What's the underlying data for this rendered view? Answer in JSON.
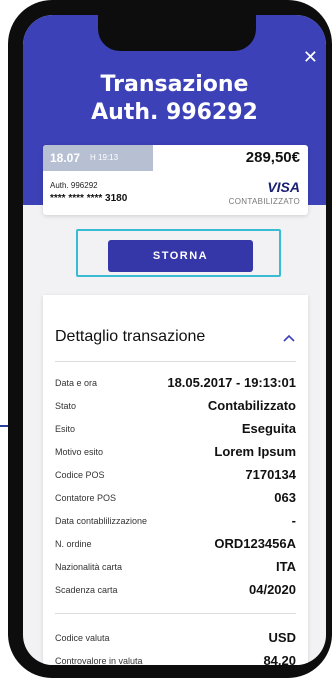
{
  "header": {
    "title_line1": "Transazione",
    "title_line2": "Auth. 996292",
    "close_label": "✕"
  },
  "card": {
    "date": "18.07",
    "time": "H 19:13",
    "amount": "289,50€",
    "auth": "Auth. 996292",
    "number": "**** **** **** 3180",
    "brand": "VISA",
    "status": "CONTABILIZZATO"
  },
  "action": {
    "storna_label": "STORNA"
  },
  "details": {
    "title": "Dettaglio transazione",
    "rows": [
      {
        "label": "Data e ora",
        "value": "18.05.2017 - 19:13:01"
      },
      {
        "label": "Stato",
        "value": "Contabilizzato"
      },
      {
        "label": "Esito",
        "value": "Eseguita"
      },
      {
        "label": "Motivo esito",
        "value": "Lorem Ipsum"
      },
      {
        "label": "Codice POS",
        "value": "7170134"
      },
      {
        "label": "Contatore POS",
        "value": "063"
      },
      {
        "label": "Data contablilizzazione",
        "value": "-"
      },
      {
        "label": "N. ordine",
        "value": "ORD123456A"
      },
      {
        "label": "Nazionalità carta",
        "value": "ITA"
      },
      {
        "label": "Scadenza carta",
        "value": "04/2020"
      }
    ],
    "rows2": [
      {
        "label": "Codice valuta",
        "value": "USD"
      },
      {
        "label": "Controvalore in valuta",
        "value": "84,20"
      }
    ]
  },
  "colors": {
    "header": "#3c41b8",
    "button": "#3536a8",
    "highlight": "#38bcd4"
  }
}
